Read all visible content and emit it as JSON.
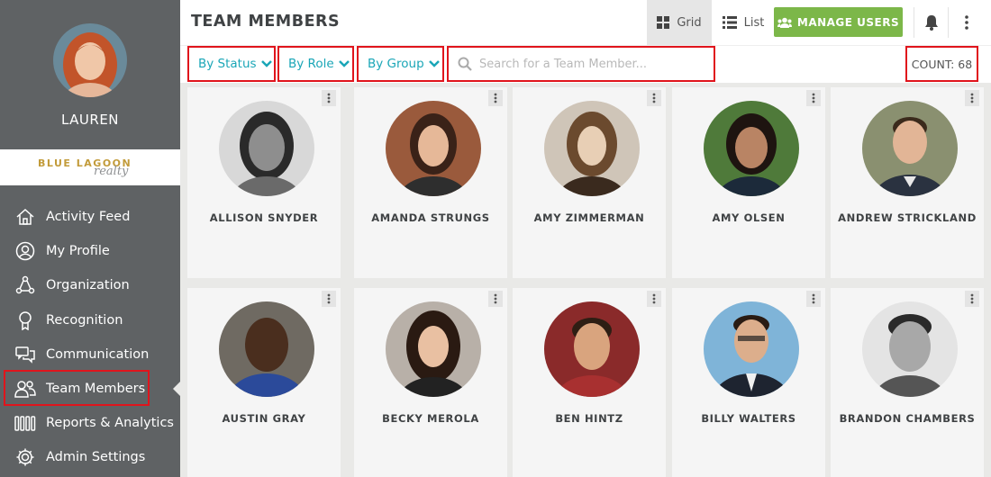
{
  "user": {
    "name": "LAUREN"
  },
  "brand": {
    "line1": "BLUE LAGOON",
    "line2": "realty"
  },
  "nav": {
    "items": [
      {
        "label": "Activity Feed",
        "icon": "home-icon"
      },
      {
        "label": "My Profile",
        "icon": "user-icon"
      },
      {
        "label": "Organization",
        "icon": "organization-icon"
      },
      {
        "label": "Recognition",
        "icon": "award-icon"
      },
      {
        "label": "Communication",
        "icon": "chat-icon"
      },
      {
        "label": "Team Members",
        "icon": "team-icon",
        "active": true
      },
      {
        "label": "Reports & Analytics",
        "icon": "bars-icon"
      },
      {
        "label": "Admin Settings",
        "icon": "gear-icon"
      }
    ]
  },
  "header": {
    "title": "TEAM MEMBERS",
    "view_grid_label": "Grid",
    "view_list_label": "List",
    "manage_users_label": "MANAGE USERS"
  },
  "filters": {
    "status_label": "By Status",
    "role_label": "By Role",
    "group_label": "By Group",
    "search_placeholder": "Search for a Team Member...",
    "count_label": "COUNT: 68"
  },
  "members": [
    {
      "name": "ALLISON SNYDER"
    },
    {
      "name": "AMANDA STRUNGS"
    },
    {
      "name": "AMY ZIMMERMAN"
    },
    {
      "name": "AMY OLSEN"
    },
    {
      "name": "ANDREW STRICKLAND"
    },
    {
      "name": "AUSTIN GRAY"
    },
    {
      "name": "BECKY MEROLA"
    },
    {
      "name": "BEN HINTZ"
    },
    {
      "name": "BILLY WALTERS"
    },
    {
      "name": "BRANDON CHAMBERS"
    }
  ],
  "colors": {
    "sidebar": "#5f6264",
    "accent": "#1aa6b7",
    "manage_button": "#7cb749",
    "highlight_border": "#e0141c"
  }
}
